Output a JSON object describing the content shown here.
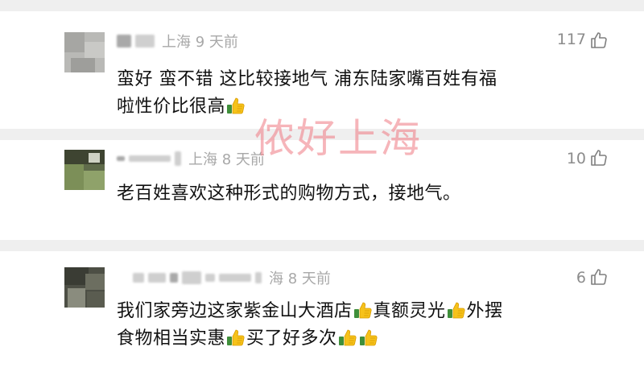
{
  "comments": [
    {
      "location": "上海 9 天前",
      "likes": "117",
      "lines": [
        "蛮好 蛮不错 这比较接地气 浦东陆家嘴百姓有福",
        "啦性价比很高"
      ]
    },
    {
      "location": "上海 8 天前",
      "likes": "10",
      "lines": [
        "老百姓喜欢这种形式的购物方式，接地气。"
      ]
    },
    {
      "location": "海 8 天前",
      "likes": "6",
      "lines": [
        "我们家旁边这家紫金山大酒店",
        "真额灵光",
        "外摆",
        "食物相当实惠",
        "买了好多次"
      ]
    }
  ],
  "watermark": "侬好上海",
  "icons": {
    "like": "thumb-up-outline-icon",
    "emoji": "thumbs-up-emoji-icon"
  },
  "colors": {
    "meta_text": "#a8a8a8",
    "like_count": "#8c8c8c",
    "watermark": "#ee7882",
    "separator": "#efefef"
  }
}
